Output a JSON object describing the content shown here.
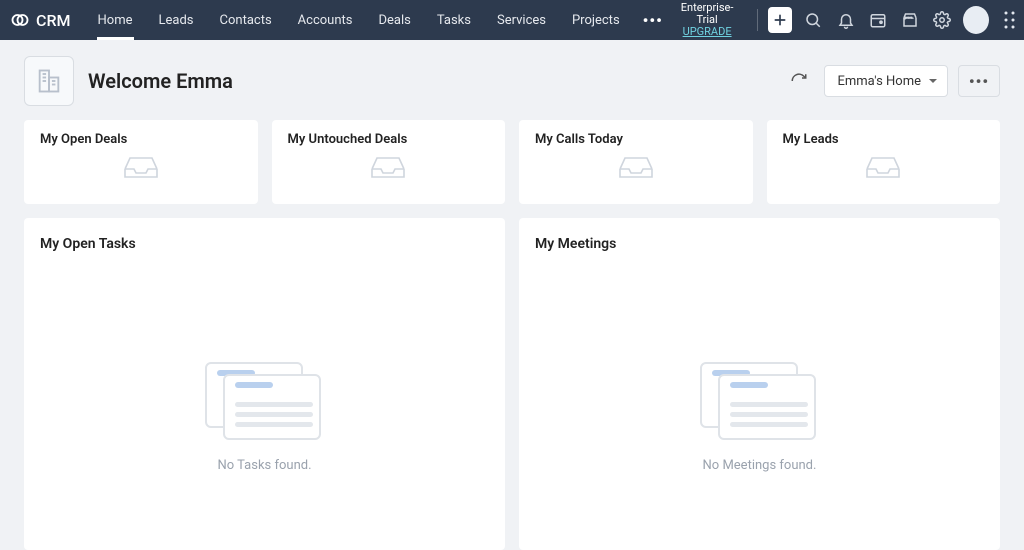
{
  "brand": {
    "name": "CRM"
  },
  "nav": {
    "tabs": [
      "Home",
      "Leads",
      "Contacts",
      "Accounts",
      "Deals",
      "Tasks",
      "Services",
      "Projects"
    ],
    "active_index": 0
  },
  "trial": {
    "label": "Enterprise-Trial",
    "upgrade": "UPGRADE"
  },
  "welcome": {
    "title": "Welcome Emma"
  },
  "view": {
    "selected": "Emma's Home"
  },
  "cards_small": [
    {
      "title": "My Open Deals"
    },
    {
      "title": "My Untouched Deals"
    },
    {
      "title": "My Calls Today"
    },
    {
      "title": "My Leads"
    }
  ],
  "cards_large": [
    {
      "title": "My Open Tasks",
      "empty": "No Tasks found."
    },
    {
      "title": "My Meetings",
      "empty": "No Meetings found."
    }
  ]
}
